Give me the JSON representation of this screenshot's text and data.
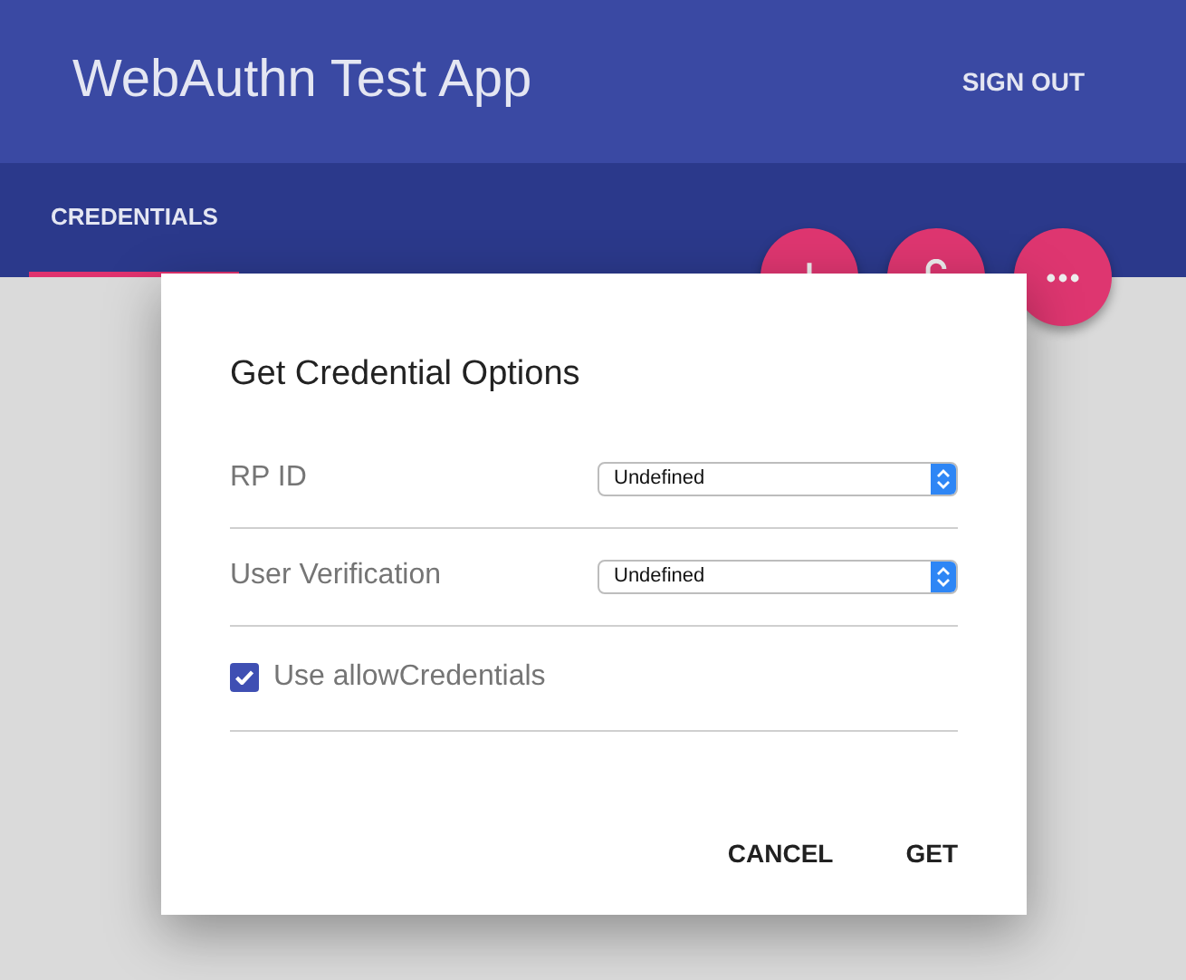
{
  "app_bar": {
    "title": "WebAuthn Test App",
    "action": "SIGN OUT"
  },
  "tabs": [
    {
      "label": "CREDENTIALS",
      "selected": true
    }
  ],
  "fab_buttons": [
    {
      "kind": "add"
    },
    {
      "kind": "lock"
    },
    {
      "kind": "more"
    }
  ],
  "dialog": {
    "title": "Get Credential Options",
    "fields": [
      {
        "label": "RP ID",
        "value": "Undefined"
      },
      {
        "label": "User Verification",
        "value": "Undefined"
      }
    ],
    "checkbox": {
      "label": "Use allowCredentials",
      "checked": true
    },
    "buttons": [
      "CANCEL",
      "GET"
    ]
  }
}
